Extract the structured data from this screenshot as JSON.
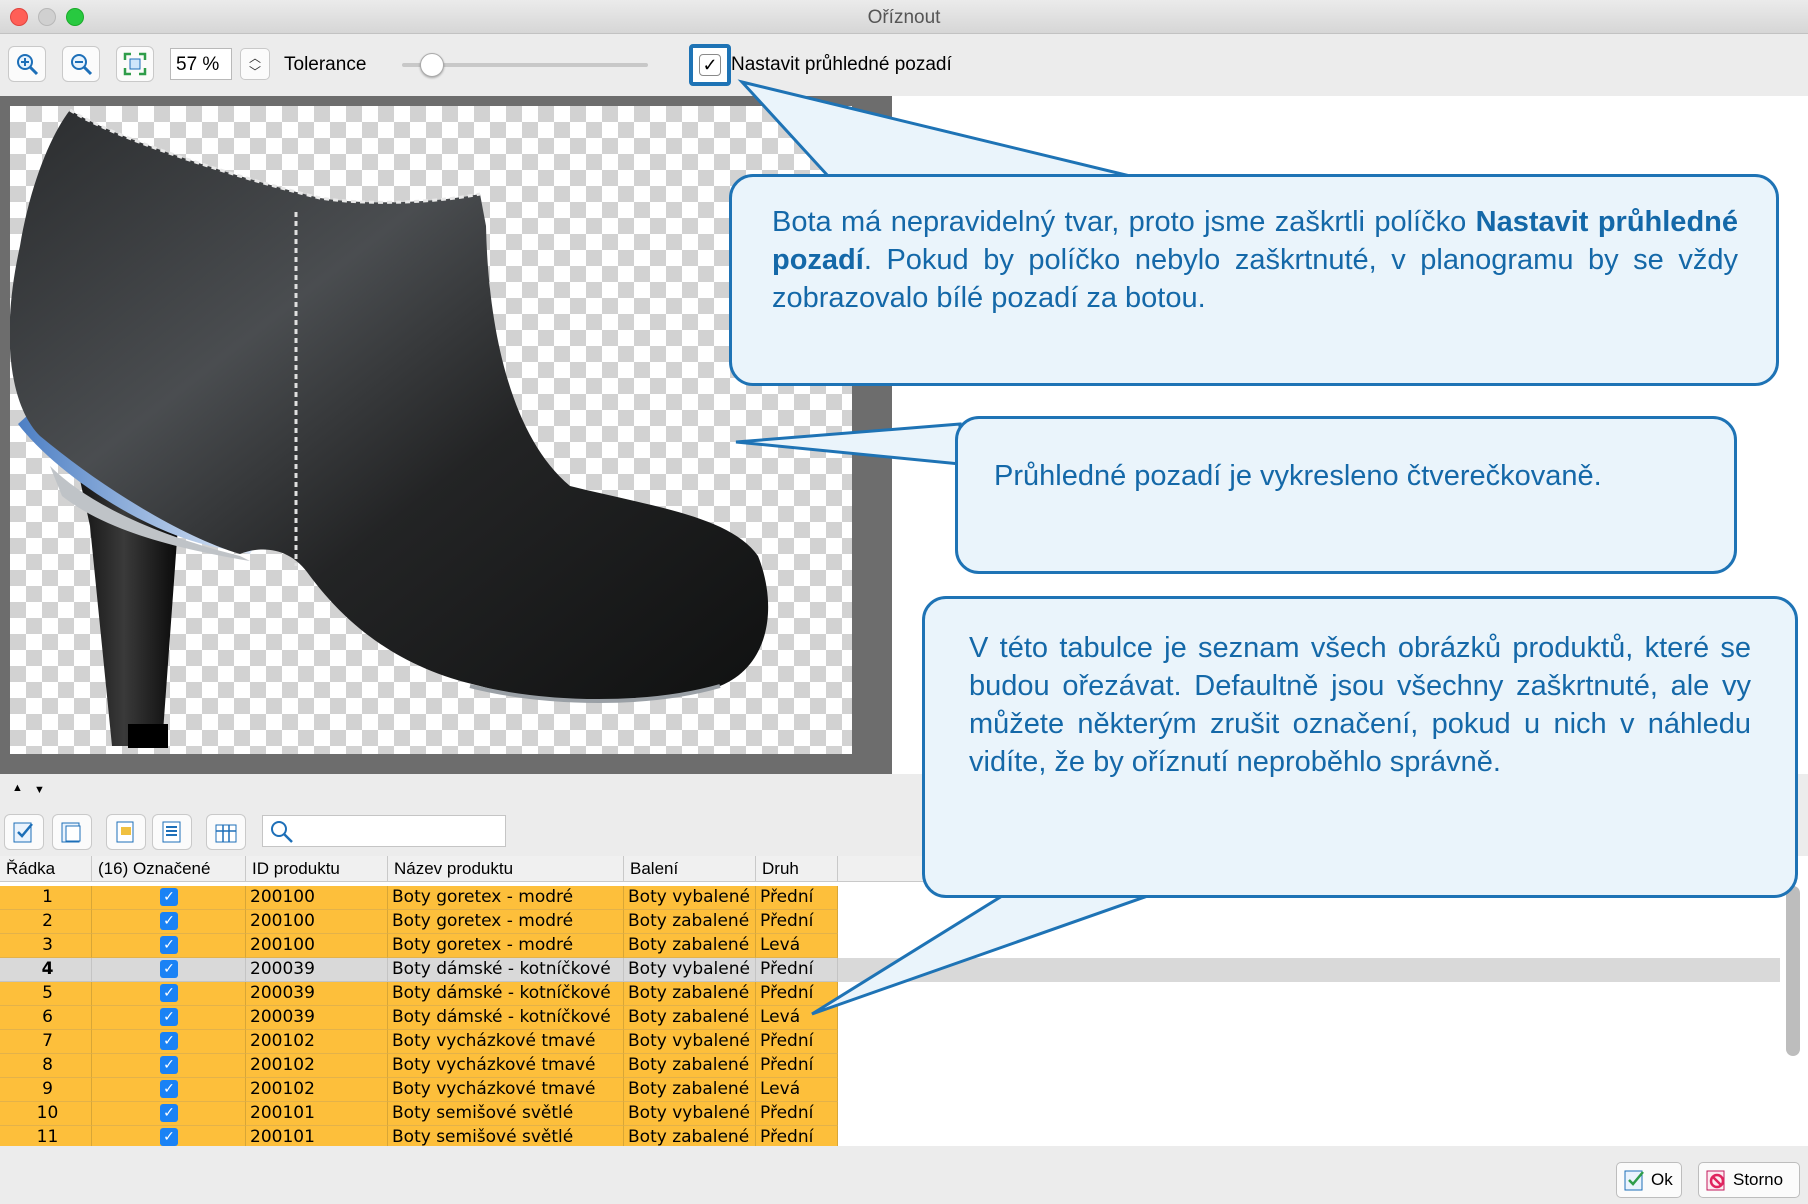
{
  "window": {
    "title": "Oříznout"
  },
  "toolbar": {
    "zoom_value": "57 %",
    "tolerance_label": "Tolerance",
    "transparent_bg_label": "Nastavit průhledné pozadí",
    "transparent_bg_checked": true,
    "tolerance_level": 0.15
  },
  "table": {
    "columns": [
      "Řádka",
      "(16) Označené",
      "ID produktu",
      "Název produktu",
      "Balení",
      "Druh"
    ],
    "rows": [
      {
        "n": "1",
        "id": "200100",
        "name": "Boty goretex - modré",
        "pack": "Boty vybalené",
        "kind": "Přední"
      },
      {
        "n": "2",
        "id": "200100",
        "name": "Boty goretex - modré",
        "pack": "Boty zabalené",
        "kind": "Přední"
      },
      {
        "n": "3",
        "id": "200100",
        "name": "Boty goretex - modré",
        "pack": "Boty zabalené",
        "kind": "Levá"
      },
      {
        "n": "4",
        "id": "200039",
        "name": "Boty dámské - kotníčkové",
        "pack": "Boty vybalené",
        "kind": "Přední"
      },
      {
        "n": "5",
        "id": "200039",
        "name": "Boty dámské - kotníčkové",
        "pack": "Boty zabalené",
        "kind": "Přední"
      },
      {
        "n": "6",
        "id": "200039",
        "name": "Boty dámské - kotníčkové",
        "pack": "Boty zabalené",
        "kind": "Levá"
      },
      {
        "n": "7",
        "id": "200102",
        "name": "Boty vycházkové tmavé",
        "pack": "Boty vybalené",
        "kind": "Přední"
      },
      {
        "n": "8",
        "id": "200102",
        "name": "Boty vycházkové tmavé",
        "pack": "Boty zabalené",
        "kind": "Přední"
      },
      {
        "n": "9",
        "id": "200102",
        "name": "Boty vycházkové tmavé",
        "pack": "Boty zabalené",
        "kind": "Levá"
      },
      {
        "n": "10",
        "id": "200101",
        "name": "Boty semišové světlé",
        "pack": "Boty vybalené",
        "kind": "Přední"
      },
      {
        "n": "11",
        "id": "200101",
        "name": "Boty semišové světlé",
        "pack": "Boty zabalené",
        "kind": "Přední"
      }
    ],
    "selected_row": "4"
  },
  "buttons": {
    "ok": "Ok",
    "cancel": "Storno"
  },
  "callouts": {
    "c1_text1": "Bota má nepravidelný tvar, proto jsme zaškrtli políčko ",
    "c1_bold": "Nastavit průhledné pozadí",
    "c1_text2": ". Pokud by políčko nebylo zaškrtnuté, v planogramu by se vždy zobrazovalo bílé pozadí za botou.",
    "c2": "Průhledné pozadí je vykresleno čtverečkovaně.",
    "c3": "V této tabulce je seznam všech obrázků produktů, které se budou ořezávat. Defaultně jsou všechny zaškrtnuté, ale vy můžete některým zrušit označení, pokud u nich v náhledu vidíte, že by oříznutí neproběhlo správně."
  },
  "colors": {
    "row_orange": "#fdbf3b",
    "row_selected": "#d9d9d9",
    "callout_border": "#1e73b5",
    "callout_text": "#1468a8"
  }
}
